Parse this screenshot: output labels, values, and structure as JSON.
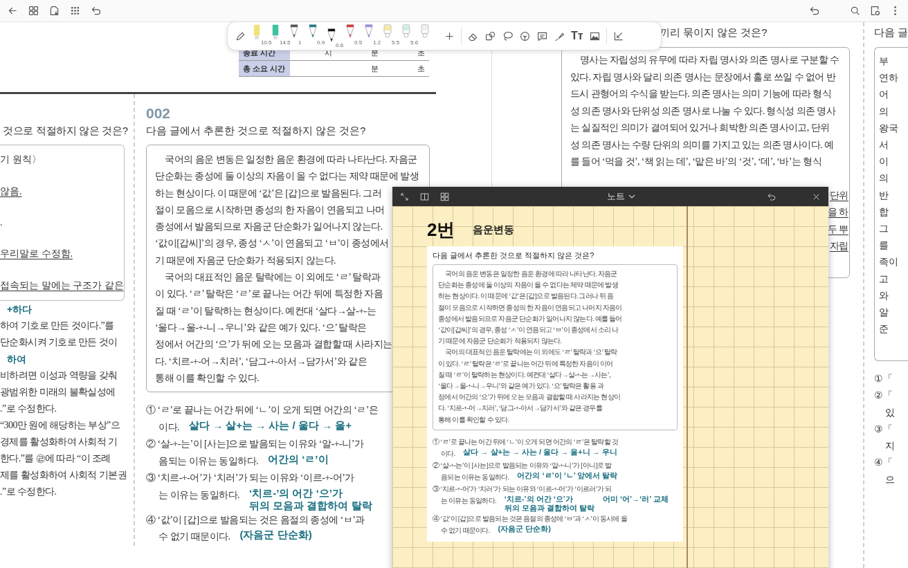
{
  "pen_toolbar": {
    "pens": [
      {
        "kind": "highlighter",
        "color": "#f2e27a",
        "size": "10.5",
        "selected": false
      },
      {
        "kind": "highlighter",
        "color": "#3fc3a0",
        "size": "14.5",
        "selected": false
      },
      {
        "kind": "pen",
        "color": "#555555",
        "size": "1",
        "selected": false
      },
      {
        "kind": "pen",
        "color": "#1b7f8e",
        "size": "0.9",
        "selected": false
      },
      {
        "kind": "pen",
        "color": "#111111",
        "size": "0.6",
        "selected": true
      },
      {
        "kind": "pen",
        "color": "#d9363e",
        "size": "0.5",
        "selected": false
      },
      {
        "kind": "pen",
        "color": "#9d90e2",
        "size": "1.2",
        "selected": false
      },
      {
        "kind": "marker",
        "color": "#f5ec9a",
        "size": "5.5",
        "selected": false
      },
      {
        "kind": "marker",
        "color": "#cdeee8",
        "size": "5.6",
        "selected": false
      },
      {
        "kind": "marker",
        "color": "#eeeeee",
        "selected": false
      }
    ],
    "text_tool": "Tт"
  },
  "timing_table": {
    "rows": [
      {
        "label": "종료 시간",
        "hour": "시",
        "minute": "분",
        "second": "초"
      },
      {
        "label": "총 소요 시간",
        "minute": "분",
        "second": "초"
      }
    ]
  },
  "left_column": {
    "question": "것으로 적절하지 않은 것은?",
    "box_lines": [
      {
        "text": "기 원칙〉",
        "underlined": false
      },
      {
        "text": "않음.",
        "underlined": true
      },
      {
        "text": ".",
        "underlined": false
      },
      {
        "text": "우리말로 수정함.",
        "underlined": true
      },
      {
        "text": "접속되는 말에는 구조가 같은",
        "underlined": true
      }
    ],
    "lines": [
      {
        "kind": "note",
        "text": "+하다"
      },
      {
        "kind": "print",
        "text": "하여 기호로 만든 것이다.”를"
      },
      {
        "kind": "print",
        "text": "단순화시켜 기호로 만든 것이"
      },
      {
        "kind": "note",
        "text": "하여"
      },
      {
        "kind": "print",
        "text": "비하려면 이성과 역량을 갖춰"
      },
      {
        "kind": "print",
        "text": "광범위한 미래의 불확실성에"
      },
      {
        "kind": "print",
        "text": ".”로 수정한다."
      },
      {
        "kind": "print",
        "text": "“300만 원에 해당하는 부상”으"
      },
      {
        "kind": "print",
        "text": "경제를 활성화하여 사회적 기"
      },
      {
        "kind": "print",
        "text": "한다.”를 ㉣에 따라 “이 조례"
      },
      {
        "kind": "print",
        "text": "제를 활성화하여 사회적 기본권"
      },
      {
        "kind": "print",
        "text": ".”로 수정한다."
      }
    ]
  },
  "question_002": {
    "number": "002",
    "question": "다음 글에서 추론한 것으로 적절하지 않은 것은?",
    "passage": [
      [
        "국어의 음운 변동은 일정한 음운 환경에 따라 나타난다. 자음군",
        "단순화는 종성에 둘 이상의 자음이 올 수 없다는 제약 때문에 발생",
        "하는 현상이다. 이 때문에 ‘값’은 [갑]으로 발음된다. 그러",
        "절이 모음으로 시작하면 종성의 한 자음이 연음되고 나머",
        "종성에서 발음되므로 자음군 단순화가 일어나지 않는다.",
        "‘값이[갑씨]’의 경우, 종성 ‘ㅅ’이 연음되고 ‘ㅂ’이 종성에서",
        "기 때문에 자음군 단순화가 적용되지 않는다."
      ],
      [
        "국어의 대표적인 음운 탈락에는 이 외에도 ‘ㄹ’ 탈락과",
        "이 있다. ‘ㄹ’ 탈락은 ‘ㄹ’로 끝나는 어간 뒤에 특정한 자음",
        "질 때 ‘ㄹ’이 탈락하는 현상이다. 예컨대 ‘살다→살-+-는",
        "‘울다→울-+-니→우니’와 같은 예가 있다. ‘으’ 탈락은",
        "정에서 어간의 ‘으’가 뒤에 오는 모음과 결합할 때 사라지는",
        "다. ‘치르-+-어→치러’, ‘담그-+-아서→담가서’와 같은",
        "통해 이를 확인할 수 있다."
      ]
    ],
    "options": [
      {
        "text": "① ‘ㄹ’로 끝나는 어간 뒤에 ‘ㄴ’이 오게 되면 어간의 ‘ㄹ’은",
        "continuation": "이다.",
        "notes": [
          [
            "살다 → 살+는 → 사는 / 울다 → 울+"
          ]
        ]
      },
      {
        "text": "② ‘살-+-는’이 [사는]으로 발음되는 이유와 ‘알-+-니’가",
        "continuation": "음되는 이유는 동일하다.",
        "notes": [
          [
            "어간의 ‘ㄹ’이"
          ]
        ]
      },
      {
        "text": "③ ‘치르-+-어’가 ‘치러’가 되는 이유와 ‘이르-+-어’가",
        "continuation": "는 이유는 동일하다.",
        "notes": [
          [
            "‘치르-’의 어간 ‘으’가",
            "뒤의 모음과 결합하여 탈락"
          ]
        ]
      },
      {
        "text": "④ ‘값’이 [갑]으로 발음되는 것은 음절의 종성에 ‘ㅂ’과",
        "continuation": "수 없기 때문이다.",
        "notes": [
          [
            "(자음군 단순화)"
          ]
        ]
      }
    ]
  },
  "question_right": {
    "title": "끼리 묶이지 않은 것은?",
    "passage": [
      "명사는 자립성의 유무에 따라 자립 명사와 의존 명사로 구분할 수",
      "있다. 자립 명사와 달리 의존 명사는 문장에서 홀로 쓰일 수 없어 반",
      "드시 관형어의 수식을 받는다. 의존 명사는 의미 기능에 따라 형식",
      "성 의존 명사와 단위성 의존 명사로 나눌 수 있다. 형식성 의존 명사",
      "는 실질적인 의미가 결여되어 있거나 희박한 의존 명사이고, 단위",
      "성 의존 명사는 수량 단위의 의미를 가지고 있는 의존 명사이다. 예",
      "를 들어 ‘먹을 것’, ‘책 읽는 데’, ‘맡은 바’의 ‘것’, ‘데’, ‘바’는 형식"
    ],
    "passage_tails": [
      "단위",
      "을 하",
      "두 뿌",
      "자립"
    ]
  },
  "far_right": {
    "title": "다음 글",
    "box_lines": [
      "부",
      "연하",
      "어",
      "의",
      "왕국",
      "서",
      "이",
      "의",
      "반",
      "합",
      "그",
      "를",
      "족이",
      "고",
      "와",
      "알",
      "준"
    ],
    "options": [
      {
        "kind": "option",
        "text": "①「"
      },
      {
        "kind": "option",
        "text": "②「"
      },
      {
        "kind": "continuation",
        "text": "있"
      },
      {
        "kind": "option",
        "text": "③「"
      },
      {
        "kind": "continuation",
        "text": "지"
      },
      {
        "kind": "option",
        "text": "④「"
      },
      {
        "kind": "continuation",
        "text": "으"
      }
    ]
  },
  "note_window": {
    "title": "노트",
    "heading": "2번",
    "topic": "음운변동",
    "question": "다음 글에서 추론한 것으로 적절하지 않은 것은?",
    "passage": [
      [
        "국어의 음운 변동은 일정한 음운 환경에 따라 나타난다. 자음군",
        "단순화는 종성에 둘 이상의 자음이 올 수 없다는 제약 때문에 발생",
        "하는 현상이다. 이 때문에 ‘값’은 [갑]으로 발음된다. 그러나 뒤 음",
        "절이 모음으로 시작하면 종성의 한 자음이 연음되고 나머지 자음이",
        "종성에서 발음되므로 자음군 단순화가 일어나지 않는다. 예를 들어",
        "‘값이[갑씨]’의 경우, 종성 ‘ㅅ’이 연음되고 ‘ㅂ’이 종성에서 소리 나",
        "기 때문에 자음군 단순화가 적용되지 않는다."
      ],
      [
        "국어의 대표적인 음운 탈락에는 이 외에도 ‘ㄹ’ 탈락과 ‘으’ 탈락",
        "이 있다. ‘ㄹ’ 탈락은 ‘ㄹ’로 끝나는 어간 뒤에 특정한 자음이 이어",
        "질 때 ‘ㄹ’이 탈락하는 현상이다. 예컨대 ‘살다→살-+-는→사는’,",
        "‘울다→울-+-니→우니’와 같은 예가 있다. ‘으’ 탈락은 활용 과",
        "정에서 어간의 ‘으’가 뒤에 오는 모음과 결합할 때 사라지는 현상이",
        "다. ‘치르-+-어→치러’, ‘담그-+-아서→담가서’와 같은 경우를",
        "통해 이를 확인할 수 있다."
      ]
    ],
    "options": [
      {
        "text": "① ‘ㄹ’로 끝나는 어간 뒤에 ‘ㄴ’이 오게 되면 어간의 ‘ㄹ’은 탈락할 것",
        "continuation": "이다.",
        "notes": [
          [
            "살다 → 살+는 → 사는 / 울다 → 울+니 → 우니"
          ]
        ]
      },
      {
        "text": "② ‘살-+-는’이 [사는]으로 발음되는 이유와 ‘알-+-니’가 [아니]로 발",
        "continuation": "음되는 이유는 동일하다.",
        "notes": [
          [
            "어간의 ‘ㄹ’이 ‘ㄴ’ 앞에서 탈락"
          ]
        ]
      },
      {
        "text": "③ ‘치르-+-어’가 ‘치러’가 되는 이유와 ‘이르-+-어’가 ‘이르러’가 되",
        "continuation": "는 이유는 동일하다.",
        "notes": [
          [
            "‘치르-’의 어간 ‘으’가",
            "뒤의 모음과 결합하여 탈락"
          ],
          [
            "어미 ‘어’→‘러’ 교체"
          ]
        ]
      },
      {
        "text": "④ ‘값’이 [갑]으로 발음되는 것은 음절의 종성에 ‘ㅂ’과 ‘ㅅ’이 동시에 올",
        "continuation": "수 없기 때문이다.",
        "notes": [
          [
            "(자음군 단순화)"
          ]
        ]
      }
    ]
  }
}
